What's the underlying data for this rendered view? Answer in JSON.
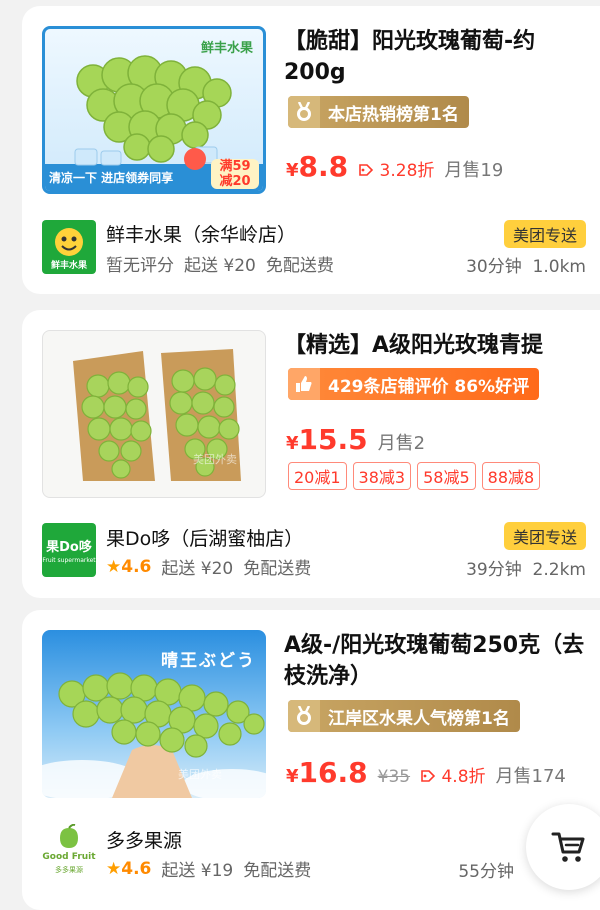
{
  "listings": [
    {
      "title": "【脆甜】阳光玫瑰葡萄-约200g",
      "badge": "本店热销榜第1名",
      "price": "8.8",
      "currency": "¥",
      "discount": "3.28折",
      "sold": "月售19",
      "image_text": {
        "brand": "鲜丰水果",
        "banner": "清凉一下 进店领券同享",
        "promo_top": "满59",
        "promo_bottom": "减20"
      },
      "shop": {
        "logo_text": "鲜丰水果",
        "name": "鲜丰水果（余华岭店）",
        "rating": "暂无评分",
        "min_order": "起送 ¥20",
        "delivery_fee": "免配送费",
        "delivery_tag": "美团专送",
        "time": "30分钟",
        "distance": "1.0km"
      }
    },
    {
      "title": "【精选】A级阳光玫瑰青提",
      "badge": "429条店铺评价 86%好评",
      "price": "15.5",
      "currency": "¥",
      "sold": "月售2",
      "promos": [
        "20减1",
        "38减3",
        "58减5",
        "88减8"
      ],
      "image_text": {
        "watermark": "美团外卖"
      },
      "shop": {
        "logo_text": "果Do哆",
        "logo_sub": "Fruit supermarket",
        "name": "果Do哆（后湖蜜柚店）",
        "rating": "4.6",
        "min_order": "起送 ¥20",
        "delivery_fee": "免配送费",
        "delivery_tag": "美团专送",
        "time": "39分钟",
        "distance": "2.2km"
      }
    },
    {
      "title": "A级-/阳光玫瑰葡萄250克（去枝洗净）",
      "badge": "江岸区水果人气榜第1名",
      "price": "16.8",
      "currency": "¥",
      "original_price": "¥35",
      "discount": "4.8折",
      "sold": "月售174",
      "image_text": {
        "title": "晴王ぶどう",
        "watermark": "美团外卖"
      },
      "shop": {
        "logo_text": "Good Fruit",
        "logo_sub": "多多果源",
        "name": "多多果源",
        "rating": "4.6",
        "min_order": "起送 ¥19",
        "delivery_fee": "免配送费",
        "time": "55分钟"
      }
    }
  ],
  "icons": {
    "badge_rank": "rank-medal-icon",
    "badge_review": "thumbs-up-icon",
    "discount": "tag-icon",
    "star": "star-icon",
    "cart": "shopping-cart-icon"
  },
  "colors": {
    "price": "#ff3a2c",
    "rating": "#ff8a00",
    "delivery_tag": "#ffcf3d",
    "badge_gold": "#b08a4a",
    "badge_orange": "#ff6a1a",
    "logo_green": "#1fa83a"
  }
}
